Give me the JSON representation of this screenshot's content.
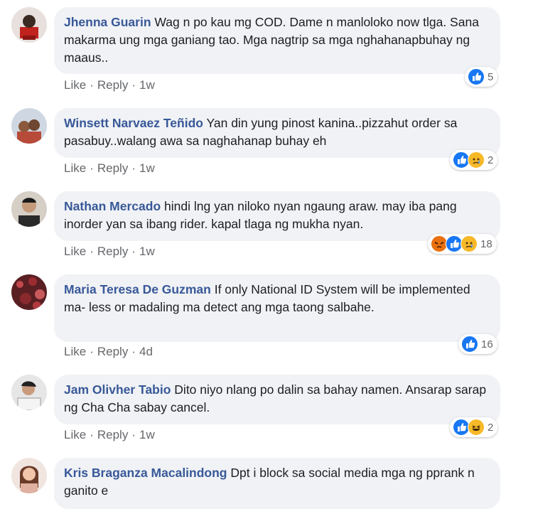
{
  "comments": [
    {
      "author": "Jhenna Guarin",
      "text": "Wag n po kau mg COD. Dame n manloloko now tlga. Sana makarma ung mga ganiang tao. Mga nagtrip sa mga nghahanapbuhay ng maaus..",
      "like": "Like",
      "reply": "Reply",
      "time": "1w",
      "reactions": [
        "like"
      ],
      "count": "5"
    },
    {
      "author": "Winsett Narvaez Teñido",
      "text": "Yan din yung pinost kanina..pizzahut order sa pasabuy..walang awa sa naghahanap buhay eh",
      "like": "Like",
      "reply": "Reply",
      "time": "1w",
      "reactions": [
        "like",
        "sad"
      ],
      "count": "2"
    },
    {
      "author": "Nathan Mercado",
      "text": "hindi lng yan niloko nyan ngaung araw. may iba pang inorder yan sa ibang rider. kapal tlaga ng mukha nyan.",
      "like": "Like",
      "reply": "Reply",
      "time": "1w",
      "reactions": [
        "angry",
        "like",
        "sad"
      ],
      "count": "18"
    },
    {
      "author": "Maria Teresa De Guzman",
      "text": "If only National ID System will be implemented ma- less or madaling ma detect ang mga taong salbahe.",
      "like": "Like",
      "reply": "Reply",
      "time": "4d",
      "reactions": [
        "like"
      ],
      "count": "16"
    },
    {
      "author": "Jam Olivher Tabio",
      "text": "Dito niyo nlang po dalin sa bahay namen. Ansarap sarap ng Cha Cha sabay cancel.",
      "like": "Like",
      "reply": "Reply",
      "time": "1w",
      "reactions": [
        "like",
        "haha"
      ],
      "count": "2"
    },
    {
      "author": "Kris Braganza Macalindong",
      "text": "Dpt i block sa social media mga ng pprank n ganito e"
    }
  ],
  "colors": {
    "author": "#385898",
    "bubble": "#f0f2f5",
    "like": "#1877f2",
    "sad": "#f7b928",
    "angry": "#e9710f"
  }
}
